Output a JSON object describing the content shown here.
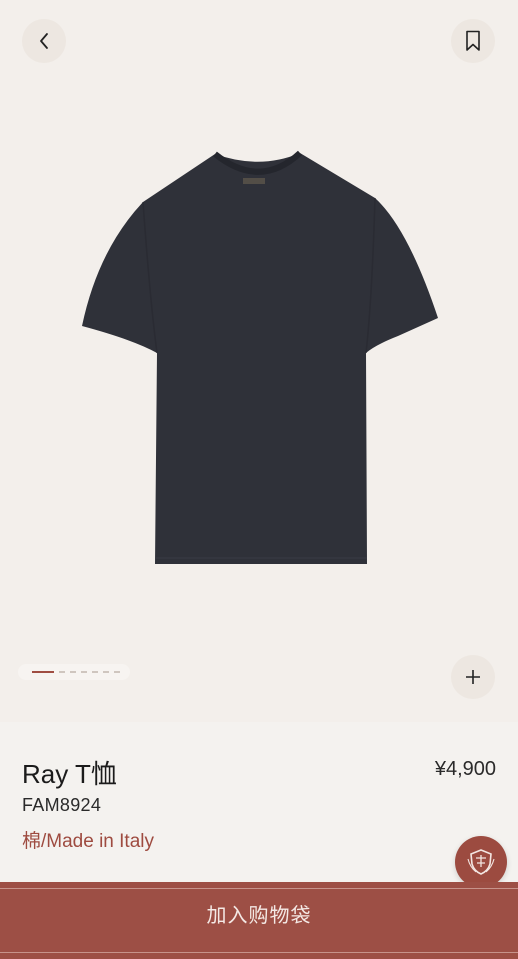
{
  "header": {
    "back_icon": "chevron-left-icon",
    "bookmark_icon": "bookmark-icon"
  },
  "gallery": {
    "image_subject": "dark navy short-sleeve t-shirt",
    "page_indicator": {
      "total": 8,
      "active": 1
    },
    "zoom_icon": "plus-icon"
  },
  "product": {
    "name": "Ray T恤",
    "price": "¥4,900",
    "sku": "FAM8924",
    "material": "棉/Made in Italy"
  },
  "chat": {
    "icon": "brand-crest-icon"
  },
  "cart": {
    "label": "加入购物袋"
  },
  "colors": {
    "accent": "#9d4f45",
    "background": "#f3efeb",
    "garment": "#2e3038"
  }
}
